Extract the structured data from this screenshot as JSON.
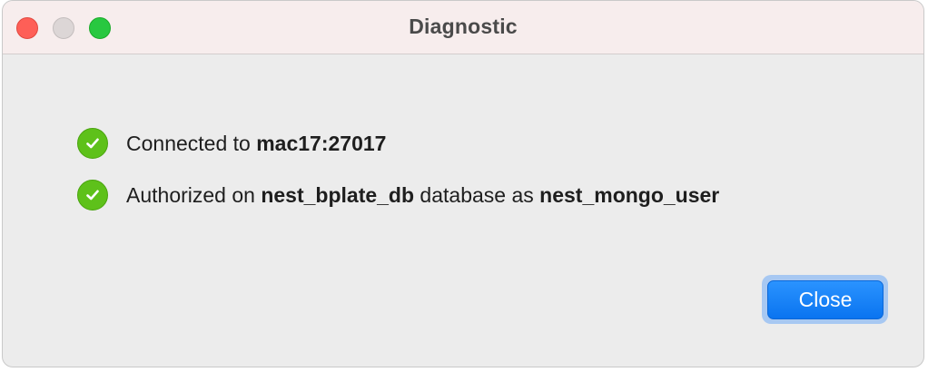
{
  "window": {
    "title": "Diagnostic"
  },
  "status": {
    "connected": {
      "prefix": "Connected to ",
      "host": "mac17:27017"
    },
    "authorized": {
      "prefix": "Authorized on ",
      "database": "nest_bplate_db",
      "middle": " database as ",
      "user": "nest_mongo_user"
    }
  },
  "footer": {
    "close_label": "Close"
  },
  "icons": {
    "status_ok": "check-circle-icon"
  },
  "colors": {
    "success_green": "#5ec11a",
    "accent_blue": "#0a74f0",
    "traffic_close": "#fe5f57",
    "traffic_zoom": "#28c840"
  }
}
